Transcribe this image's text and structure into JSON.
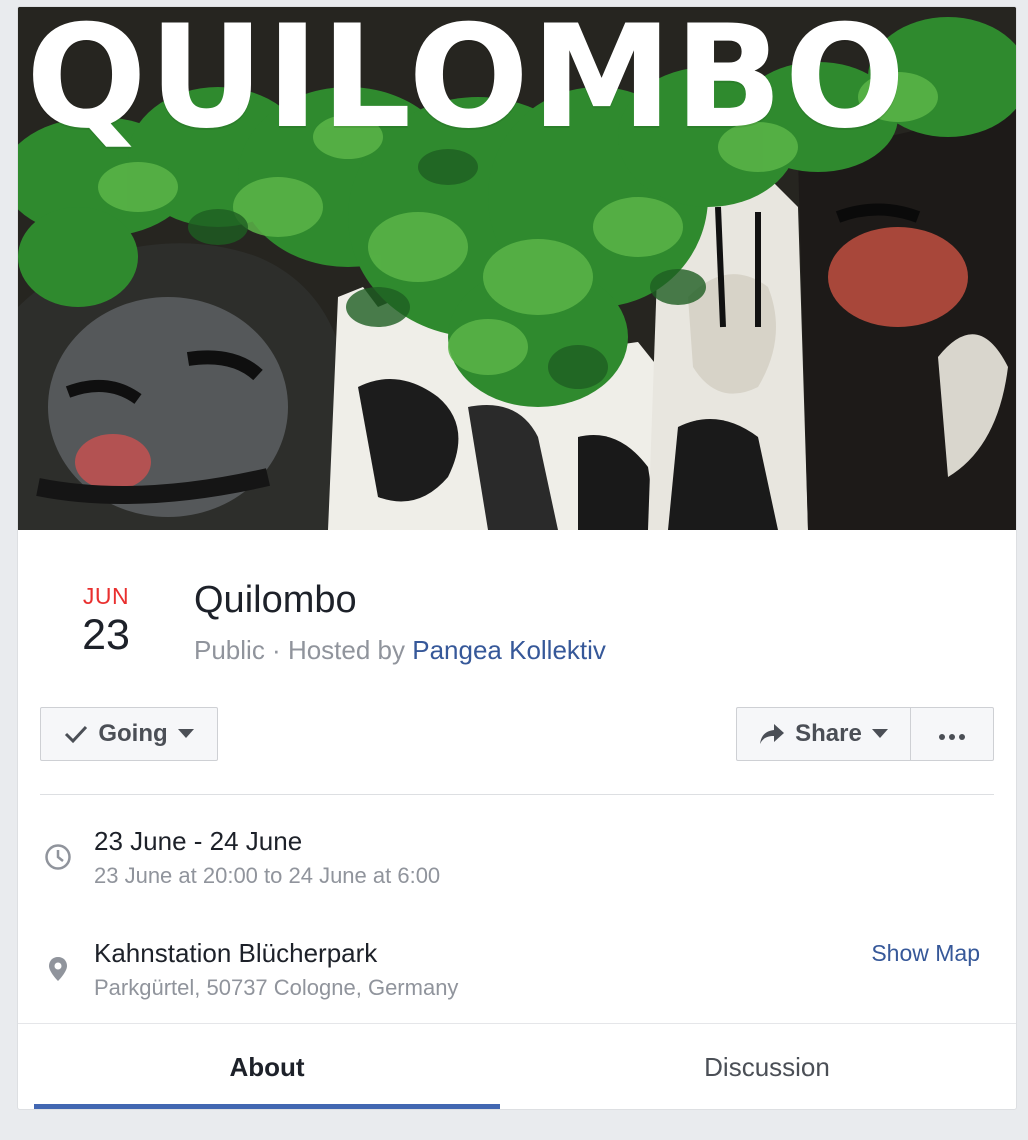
{
  "cover": {
    "title": "QUILOMBO"
  },
  "event": {
    "month": "JUN",
    "day": "23",
    "title": "Quilombo",
    "privacy": "Public",
    "separator": " · ",
    "hosted_by_prefix": "Hosted by ",
    "host": "Pangea Kollektiv"
  },
  "actions": {
    "going_label": "Going",
    "share_label": "Share",
    "more_icon": "ellipsis-icon"
  },
  "details": {
    "time_main": "23 June - 24 June",
    "time_sub": "23 June at 20:00 to 24 June at 6:00",
    "time_icon": "clock-icon",
    "place_main": "Kahnstation Blücherpark",
    "place_sub": "Parkgürtel, 50737 Cologne, Germany",
    "place_icon": "location-pin-icon",
    "show_map": "Show Map"
  },
  "tabs": [
    {
      "label": "About",
      "active": true
    },
    {
      "label": "Discussion",
      "active": false
    }
  ],
  "colors": {
    "accent": "#4267b2",
    "link": "#365899",
    "date_red": "#e9302f"
  }
}
